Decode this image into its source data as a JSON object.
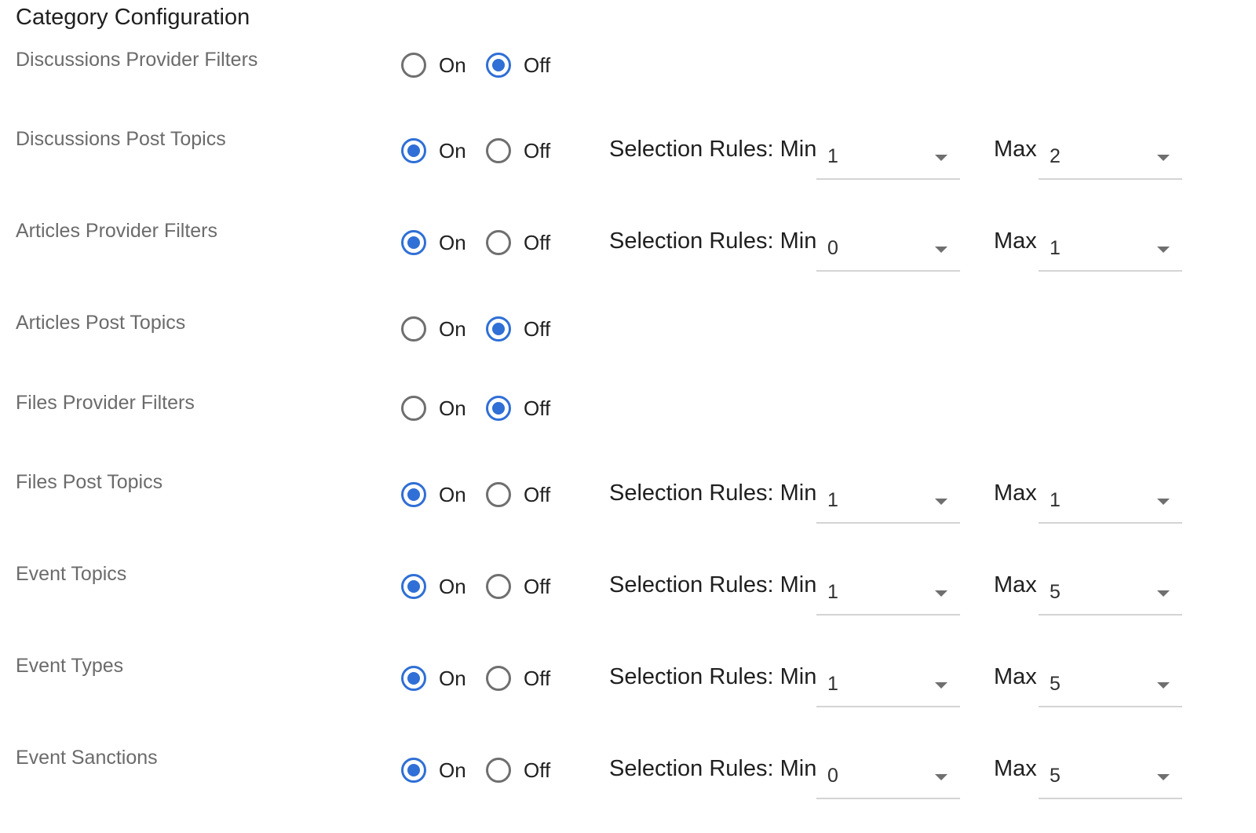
{
  "title": "Category Configuration",
  "option_on_label": "On",
  "option_off_label": "Off",
  "rules_label": "Selection Rules: Min",
  "max_label": "Max",
  "colors": {
    "accent": "#2f6fd6",
    "label_text": "#6b6b6b",
    "primary_text": "#1f1f1f",
    "unchecked_border": "#6f6f6f",
    "underline": "#d4d4d4"
  },
  "rows": [
    {
      "label": "Discussions Provider Filters",
      "selected": "Off",
      "min": null,
      "max": null
    },
    {
      "label": "Discussions Post Topics",
      "selected": "On",
      "min": "1",
      "max": "2"
    },
    {
      "label": "Articles Provider Filters",
      "selected": "On",
      "min": "0",
      "max": "1"
    },
    {
      "label": "Articles Post Topics",
      "selected": "Off",
      "min": null,
      "max": null
    },
    {
      "label": "Files Provider Filters",
      "selected": "Off",
      "min": null,
      "max": null
    },
    {
      "label": "Files Post Topics",
      "selected": "On",
      "min": "1",
      "max": "1"
    },
    {
      "label": "Event Topics",
      "selected": "On",
      "min": "1",
      "max": "5"
    },
    {
      "label": "Event Types",
      "selected": "On",
      "min": "1",
      "max": "5"
    },
    {
      "label": "Event Sanctions",
      "selected": "On",
      "min": "0",
      "max": "5"
    }
  ]
}
